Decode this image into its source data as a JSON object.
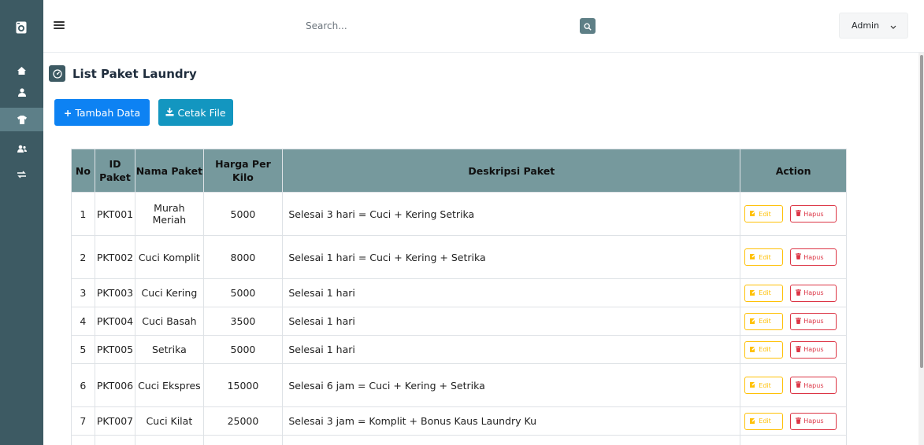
{
  "topbar": {
    "search_placeholder": "Search...",
    "user_label": "Admin"
  },
  "page": {
    "title": "List Paket Laundry"
  },
  "toolbar": {
    "add_label": "Tambah Data",
    "print_label": "Cetak File"
  },
  "table": {
    "headers": {
      "no": "No",
      "id": "ID Paket",
      "nama": "Nama Paket",
      "harga": "Harga Per Kilo",
      "deskripsi": "Deskripsi Paket",
      "action": "Action"
    },
    "rows": [
      {
        "no": "1",
        "id": "PKT001",
        "nama": "Murah Meriah",
        "harga": "5000",
        "deskripsi": "Selesai 3 hari = Cuci + Kering Setrika"
      },
      {
        "no": "2",
        "id": "PKT002",
        "nama": "Cuci Komplit",
        "harga": "8000",
        "deskripsi": "Selesai 1 hari = Cuci + Kering + Setrika"
      },
      {
        "no": "3",
        "id": "PKT003",
        "nama": "Cuci Kering",
        "harga": "5000",
        "deskripsi": "Selesai 1 hari"
      },
      {
        "no": "4",
        "id": "PKT004",
        "nama": "Cuci Basah",
        "harga": "3500",
        "deskripsi": "Selesai 1 hari"
      },
      {
        "no": "5",
        "id": "PKT005",
        "nama": "Setrika",
        "harga": "5000",
        "deskripsi": "Selesai 1 hari"
      },
      {
        "no": "6",
        "id": "PKT006",
        "nama": "Cuci Ekspres",
        "harga": "15000",
        "deskripsi": "Selesai 6 jam = Cuci + Kering + Setrika"
      },
      {
        "no": "7",
        "id": "PKT007",
        "nama": "Cuci Kilat",
        "harga": "25000",
        "deskripsi": "Selesai 3 jam = Komplit + Bonus Kaus Laundry Ku"
      }
    ],
    "edit_label": "Edit",
    "delete_label": "Hapus"
  },
  "colors": {
    "sidebar": "#3d5a63",
    "table_header": "#76999d",
    "add_button": "#0d82f3",
    "print_button": "#1396c0",
    "edit": "#ffc107",
    "delete": "#dc3545"
  },
  "icons": {
    "sidebar": [
      "washing-machine-icon",
      "home-icon",
      "user-icon",
      "shirt-icon",
      "users-icon",
      "exchange-icon"
    ],
    "topbar": [
      "menu-icon",
      "search-icon",
      "chevron-down-icon"
    ]
  }
}
